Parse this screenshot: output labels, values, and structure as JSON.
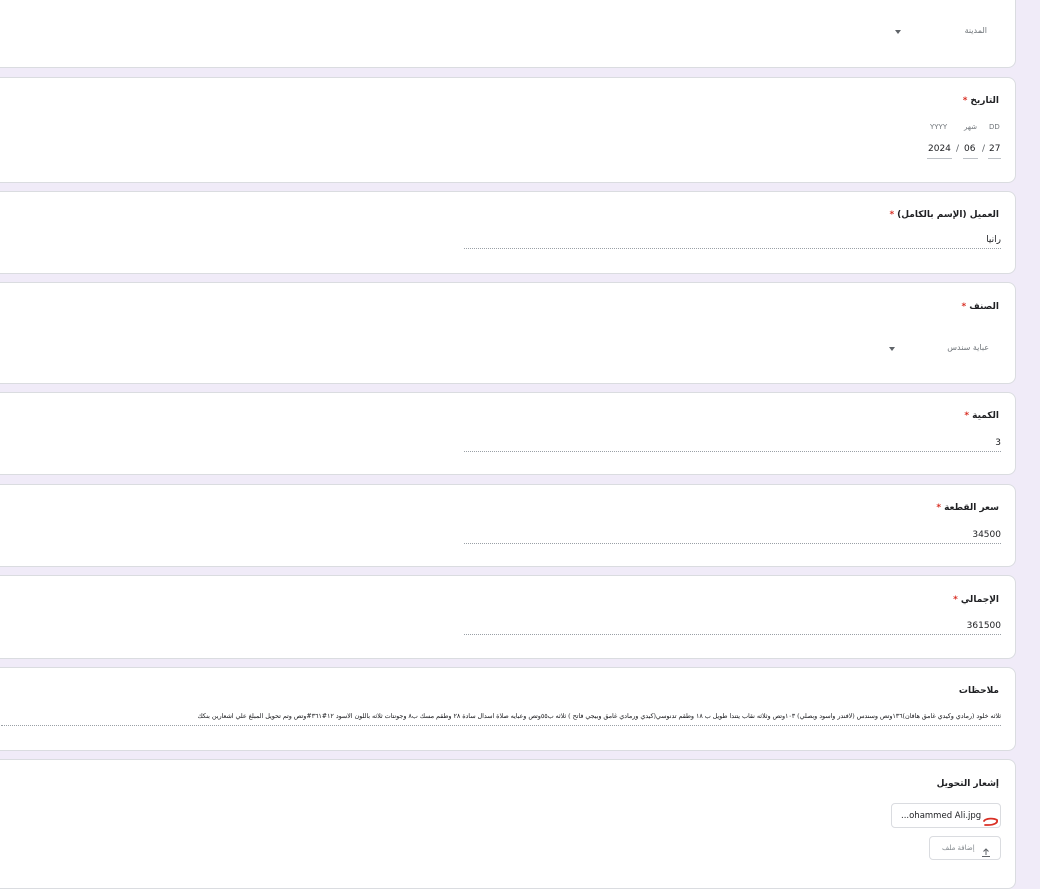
{
  "city": {
    "label": "المدينة"
  },
  "date": {
    "title": "التاريخ",
    "day_caption": "DD",
    "month_caption": "شهر",
    "year_caption": "YYYY",
    "day": "27",
    "month": "06",
    "year": "2024",
    "separator": "/"
  },
  "client": {
    "title": "العميل (الإسم بالكامل)",
    "value": "رانيا"
  },
  "category": {
    "title": "الصنف",
    "value": "عباية سندس"
  },
  "quantity": {
    "title": "الكمية",
    "value": "3"
  },
  "unit_price": {
    "title": "سعر القطعة",
    "value": "34500"
  },
  "total": {
    "title": "الإجمالي",
    "value": "361500"
  },
  "notes": {
    "title": "ملاحظات",
    "value": "ثلاثه خلود (رمادي وكيدي غامق هافان)١٣٦وتص وسندس (لافندر واسود وبصلي) ١٠٣وتص وثلاثه نقاب يتندا طويل ب ١٨ وطقم تدنوسي(كيدي ورمادي غامق  وبيجي فاتح ) ثلاثه ب٥٥وتص وعبايه صلاة اسدال سادة ٢٨ وطقم مسك ب٨ وجونتات ثلاثه باللون الاسود ١٢#٣٦١#وتص وتم تحويل المبلغ علي اشعارين بنكك"
  },
  "transfer": {
    "title": "إشعار التحويل",
    "file_name": "...ohammed Ali.jpg",
    "add_file_label": "إضافة ملف"
  },
  "required_mark": "*",
  "colors": {
    "required": "#d93025",
    "background": "#f0ebf8",
    "file_icon": "#d93025"
  }
}
